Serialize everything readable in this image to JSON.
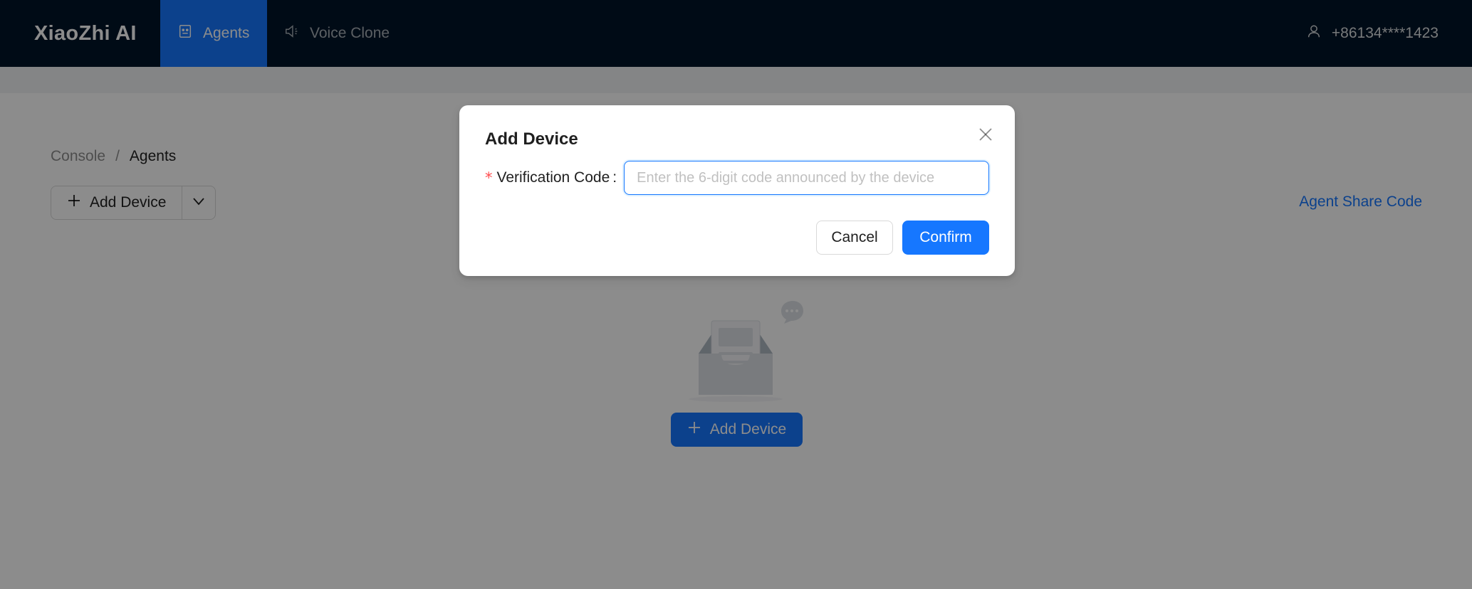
{
  "app": {
    "title": "XiaoZhi AI"
  },
  "nav": {
    "items": [
      {
        "label": "Agents",
        "icon": "robot-icon",
        "active": true
      },
      {
        "label": "Voice Clone",
        "icon": "sound-icon",
        "active": false
      }
    ],
    "user": {
      "phone": "+86134****1423",
      "icon": "user-icon"
    }
  },
  "breadcrumb": {
    "root": "Console",
    "separator": "/",
    "current": "Agents"
  },
  "toolbar": {
    "add_device_label": "Add Device",
    "share_link": "Agent Share Code"
  },
  "empty_state": {
    "add_device_label": "Add Device"
  },
  "modal": {
    "title": "Add Device",
    "field_label": "Verification Code",
    "required_mark": "*",
    "colon": ":",
    "input_placeholder": "Enter the 6-digit code announced by the device",
    "input_value": "",
    "cancel_label": "Cancel",
    "confirm_label": "Confirm"
  },
  "colors": {
    "nav_bg": "#001529",
    "primary": "#1677ff",
    "required": "#ff4d4f"
  }
}
